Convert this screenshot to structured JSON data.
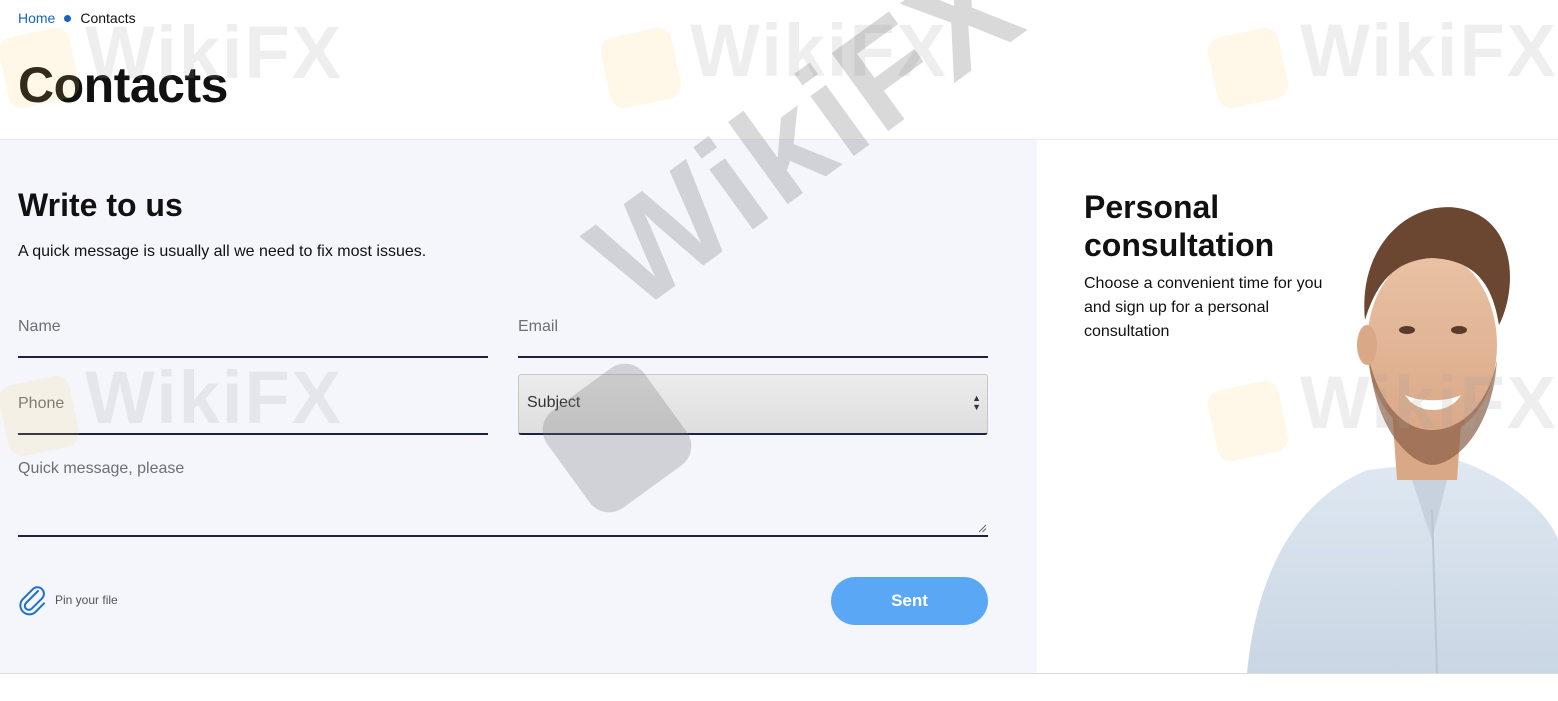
{
  "breadcrumb": {
    "home": "Home",
    "current": "Contacts"
  },
  "page_title": "Contacts",
  "form": {
    "heading": "Write to us",
    "subheading": "A quick message is usually all we need to fix most issues.",
    "name_placeholder": "Name",
    "email_placeholder": "Email",
    "phone_placeholder": "Phone",
    "subject_selected": "Subject",
    "message_placeholder": "Quick message, please",
    "pin_label": "Pin your file",
    "submit_label": "Sent"
  },
  "consultation": {
    "title": "Personal consultation",
    "text": "Choose a convenient time for you and sign up for a personal consultation"
  },
  "watermark": {
    "text": "WikiFX"
  },
  "colors": {
    "accent": "#1565c0",
    "button": "#5aa8f5",
    "form_bg": "#f4f6fc",
    "underline": "#1b2340"
  },
  "icons": [
    "paperclip-icon",
    "select-arrows-icon",
    "resize-grip-icon"
  ]
}
